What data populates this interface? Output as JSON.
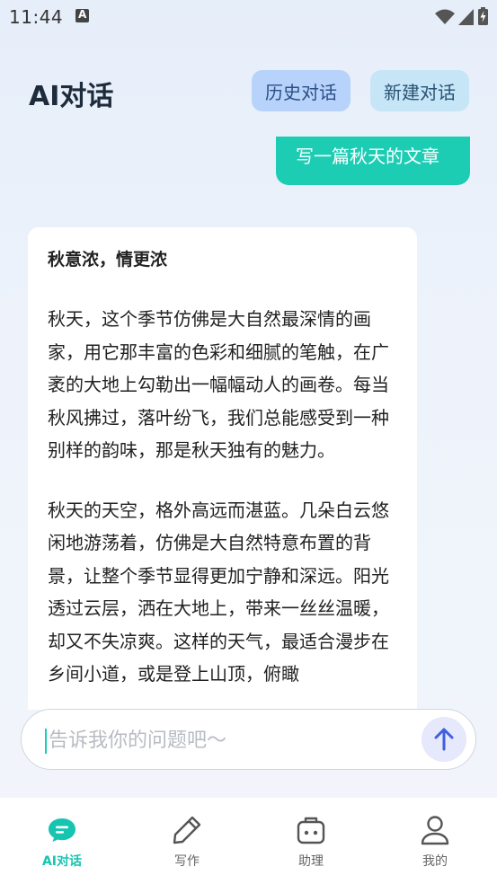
{
  "status_bar": {
    "time": "11:44",
    "icons": [
      "notification-a-icon",
      "wifi-icon",
      "signal-icon",
      "battery-charging-icon"
    ]
  },
  "header": {
    "title": "AI对话",
    "history_button": "历史对话",
    "new_button": "新建对话"
  },
  "chat": {
    "user_message": "写一篇秋天的文章",
    "ai_response": {
      "title": "秋意浓，情更浓",
      "paragraphs": [
        "秋天，这个季节仿佛是大自然最深情的画家，用它那丰富的色彩和细腻的笔触，在广袤的大地上勾勒出一幅幅动人的画卷。每当秋风拂过，落叶纷飞，我们总能感受到一种别样的韵味，那是秋天独有的魅力。",
        "秋天的天空，格外高远而湛蓝。几朵白云悠闲地游荡着，仿佛是大自然特意布置的背景，让整个季节显得更加宁静和深远。阳光透过云层，洒在大地上，带来一丝丝温暖，却又不失凉爽。这样的天气，最适合漫步在乡间小道，或是登上山顶，俯瞰"
      ]
    }
  },
  "input": {
    "placeholder": "告诉我你的问题吧～",
    "value": ""
  },
  "bottom_nav": {
    "items": [
      {
        "label": "AI对话",
        "icon": "chat-bubble-icon",
        "active": true
      },
      {
        "label": "写作",
        "icon": "pen-icon",
        "active": false
      },
      {
        "label": "助理",
        "icon": "robot-icon",
        "active": false
      },
      {
        "label": "我的",
        "icon": "person-icon",
        "active": false
      }
    ]
  },
  "colors": {
    "accent": "#1ccdb4",
    "history_button_bg": "#b7d3fb",
    "new_button_bg": "#c6e6f7",
    "send_button_bg": "#e6e8fb",
    "send_arrow": "#3f5ee0"
  }
}
